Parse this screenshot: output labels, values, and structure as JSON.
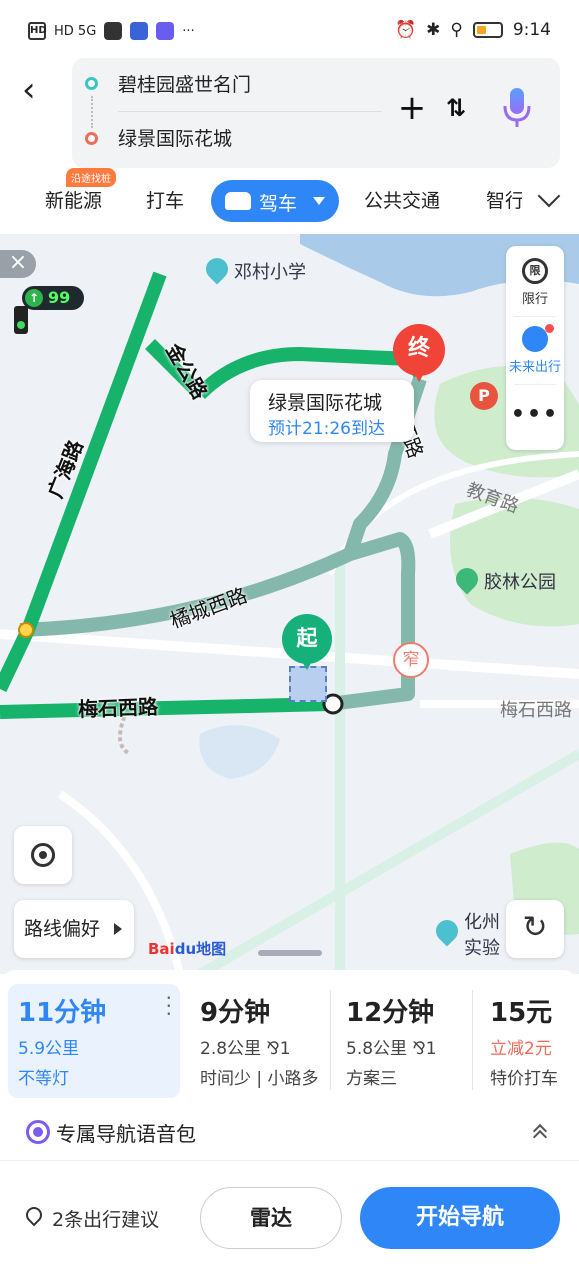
{
  "status_bar": {
    "left_text": "HD 5G",
    "time": "9:14"
  },
  "search": {
    "origin": "碧桂园盛世名门",
    "destination": "绿景国际花城"
  },
  "tabs": {
    "badge": "沿途找桩",
    "items": [
      "新能源",
      "打车",
      "驾车",
      "公共交通",
      "智行"
    ],
    "active": "驾车"
  },
  "map": {
    "traffic_light_count": "99",
    "pois": [
      "邓村小学",
      "胶林公园",
      "化州",
      "实验"
    ],
    "roads": [
      "金公路",
      "广海路",
      "橘城西路",
      "梅石西路",
      "西环路",
      "教育路",
      "梅石西路"
    ],
    "side_panel": {
      "limit": "限行",
      "limit_icon": "限",
      "future": "未来出行",
      "more": "•••"
    },
    "destination_callout": {
      "name": "绿景国际花城",
      "eta": "预计21:26到达"
    },
    "end_marker": "终",
    "start_marker": "起",
    "narrow_marker": "窄",
    "parking_marker": "P",
    "route_pref": "路线偏好",
    "logo_a": "Bai",
    "logo_b": "du地图"
  },
  "routes": [
    {
      "time": "11分钟",
      "dist": "5.9公里",
      "tag": "不等灯"
    },
    {
      "time": "9分钟",
      "dist": "2.8公里 ⅋1",
      "tag": "时间少 | 小路多"
    },
    {
      "time": "12分钟",
      "dist": "5.8公里 ⅋1",
      "tag": "方案三"
    },
    {
      "time": "15元",
      "dist": "立减2元",
      "tag": "特价打车"
    }
  ],
  "voice_pack": "专属导航语音包",
  "bottom": {
    "suggestion": "2条出行建议",
    "radar": "雷达",
    "start_nav": "开始导航"
  },
  "colors": {
    "accent": "#2f86f6",
    "route_green": "#17b36b",
    "alt_route": "#85b8ac",
    "end_red": "#f04438"
  }
}
